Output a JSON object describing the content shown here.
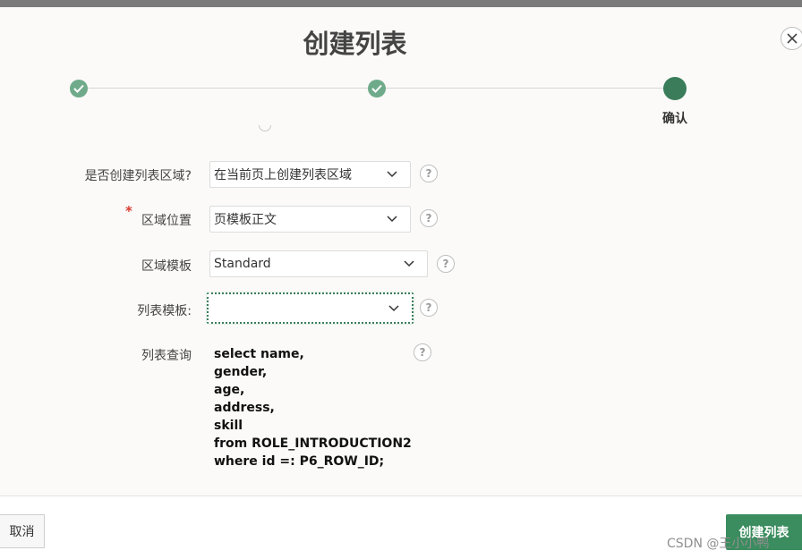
{
  "dialog": {
    "title": "创建列表",
    "close_icon": "close-icon"
  },
  "wizard": {
    "steps": [
      {
        "state": "complete",
        "icon": "check-icon"
      },
      {
        "state": "complete",
        "icon": "check-icon"
      },
      {
        "state": "current",
        "label": "确认"
      }
    ],
    "colors": {
      "complete": "#6fab8b",
      "current": "#3b7d5a"
    }
  },
  "form": {
    "create_region": {
      "label": "是否创建列表区域?",
      "value": "在当前页上创建列表区域"
    },
    "region_position": {
      "label": "区域位置",
      "required_mark": "*",
      "value": "页模板正文"
    },
    "region_template": {
      "label": "区域模板",
      "value": "Standard"
    },
    "list_template": {
      "label": "列表模板:",
      "value": ""
    },
    "list_query": {
      "label": "列表查询",
      "sql": "select name,\ngender,\nage,\naddress,\nskill\nfrom ROLE_INTRODUCTION2\nwhere id =: P6_ROW_ID;"
    },
    "help_icon_text": "?"
  },
  "footer": {
    "cancel_label": "取消",
    "create_label": "创建列表",
    "accent_color": "#3b8c5e"
  },
  "watermark": "CSDN @王小小鸭"
}
